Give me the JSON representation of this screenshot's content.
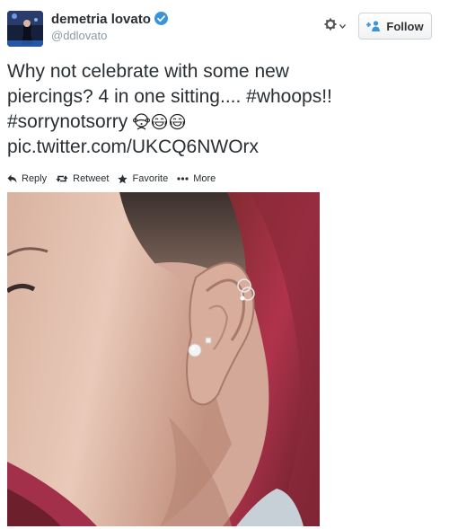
{
  "user": {
    "display_name": "demetria lovato",
    "handle": "@ddlovato"
  },
  "header": {
    "follow_label": "Follow"
  },
  "tweet": {
    "line1": "Why not celebrate with some new",
    "line2_text": "piercings? 4 in one sitting.... ",
    "line2_tag": "#whoops!!",
    "line3_tag": "#sorrynotsorry",
    "line4_link": "pic.twitter.com/UKCQ6NWOrx"
  },
  "actions": {
    "reply": "Reply",
    "retweet": "Retweet",
    "favorite": "Favorite",
    "more": "More"
  },
  "colors": {
    "verified": "#3b94d9",
    "follow_icon": "#3b94d9",
    "hair": "#b0334c"
  },
  "icons": [
    "verified-badge-icon",
    "gear-icon",
    "chevron-down-icon",
    "follow-user-icon",
    "reply-icon",
    "retweet-icon",
    "favorite-star-icon",
    "more-dots-icon",
    "see-no-evil-monkey-emoji",
    "tears-of-joy-emoji"
  ]
}
